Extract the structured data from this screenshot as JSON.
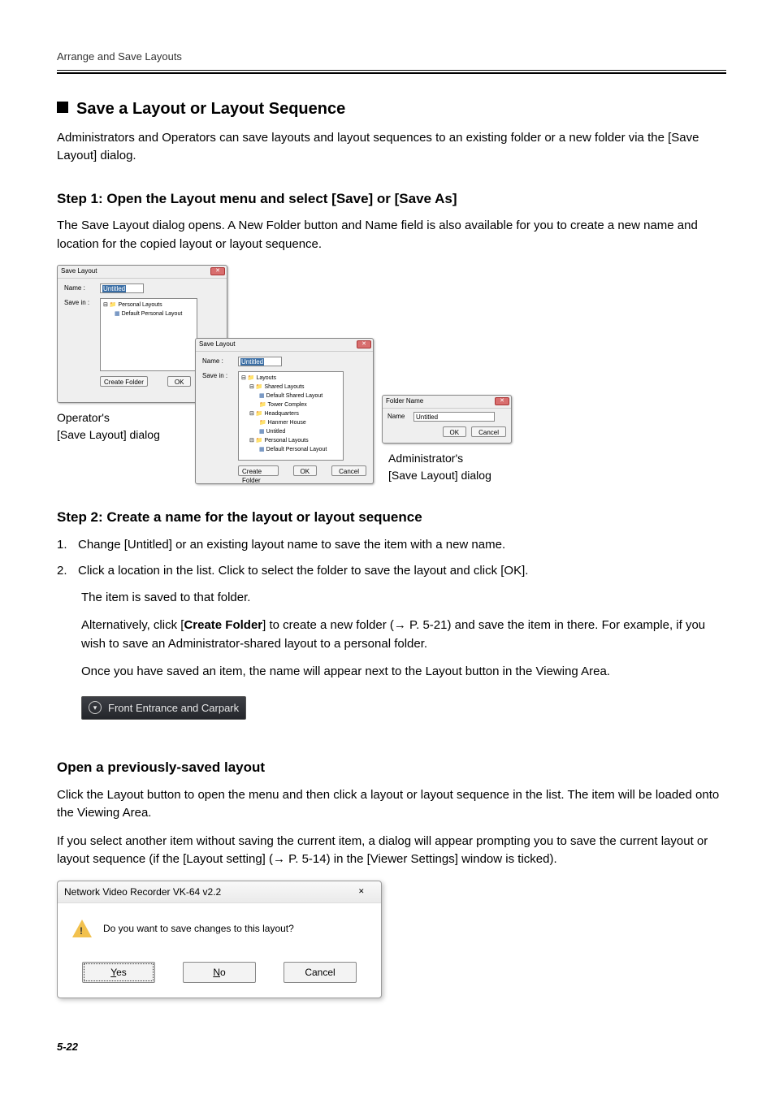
{
  "header": "Arrange and Save Layouts",
  "section_title": "Save a Layout or Layout Sequence",
  "intro_p1": "Administrators and Operators can save layouts and layout sequences to an existing folder or a new folder via the [Save Layout] dialog.",
  "step1_title": "Step 1: Open the Layout menu and select [Save] or [Save As]",
  "step1_p1": "The Save Layout dialog opens. A New Folder button and Name field is also available for you to create a new name and location for the copied layout or layout sequence.",
  "dlg_operator": {
    "title": "Save Layout",
    "name_label": "Name :",
    "name_value": "Untitled",
    "savein_label": "Save in :",
    "tree": {
      "root": "Personal Layouts",
      "item1": "Default Personal Layout"
    },
    "create_folder": "Create Folder",
    "ok": "OK"
  },
  "caption_operator_l1": "Operator's",
  "caption_operator_l2": "[Save Layout] dialog",
  "dlg_admin": {
    "title": "Save Layout",
    "name_label": "Name :",
    "name_value": "Untitled",
    "savein_label": "Save in :",
    "tree": {
      "root": "Layouts",
      "shared": "Shared Layouts",
      "shared_default": "Default Shared Layout",
      "tower": "Tower Complex",
      "hq": "Headquarters",
      "hanmer": "Hanmer House",
      "untitled": "Untitled",
      "personal": "Personal Layouts",
      "personal_default": "Default Personal Layout"
    },
    "create_folder": "Create Folder",
    "ok": "OK",
    "cancel": "Cancel"
  },
  "dlg_foldername": {
    "title": "Folder Name",
    "name_label": "Name",
    "name_value": "Untitled",
    "ok": "OK",
    "cancel": "Cancel"
  },
  "caption_admin_l1": "Administrator's",
  "caption_admin_l2": "[Save Layout] dialog",
  "step2_title": "Step 2: Create a name for the layout or layout sequence",
  "step2_li1": "Change [Untitled] or an existing layout name to save the item with a new name.",
  "step2_li2": "Click a location in the list. Click to select the folder to save the layout and click [OK].",
  "step2_ind1": "The item is saved to that folder.",
  "step2_ind2a": "Alternatively, click [",
  "step2_ind2b": "Create Folder",
  "step2_ind2c": "] to create a new folder (→ P. 5-21) and save the item in there. For example, if you wish to save an Administrator-shared layout to a personal folder.",
  "step2_ind3": "Once you have saved an item, the name will appear next to the Layout button in the Viewing Area.",
  "layout_button_text": "Front Entrance and Carpark",
  "open_prev_title": "Open a previously-saved layout",
  "open_prev_p1": "Click the Layout button to open the menu and then click a layout or layout sequence in the list. The item will be loaded onto the Viewing Area.",
  "open_prev_p2a": "If you select another item without saving the current item, a dialog will appear prompting you to save the current layout or layout sequence (if the [",
  "open_prev_p2b": "Layout setting",
  "open_prev_p2c": "] (→ P. 5-14) in the [",
  "open_prev_p2d": "Viewer Settings",
  "open_prev_p2e": "] window is ticked).",
  "confirm": {
    "title": "Network Video Recorder VK-64 v2.2",
    "message": "Do you want to save changes to this layout?",
    "yes": "es",
    "no": "o",
    "cancel": "Cancel"
  },
  "pagenum": "5-22"
}
